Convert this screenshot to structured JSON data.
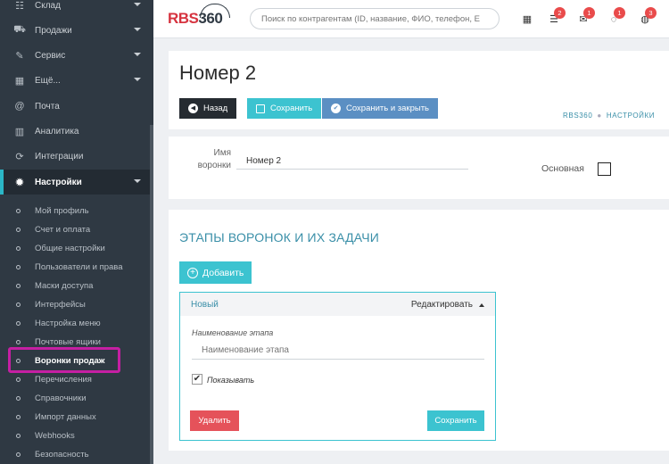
{
  "sidebar": {
    "items": [
      {
        "label": "Склад",
        "icon": "cubes-icon",
        "glyph": "☷",
        "caret": true
      },
      {
        "label": "Продажи",
        "icon": "cart-icon",
        "glyph": "⛟",
        "caret": true
      },
      {
        "label": "Сервис",
        "icon": "wrench-icon",
        "glyph": "✎",
        "caret": true
      },
      {
        "label": "Ещё...",
        "icon": "grid-icon",
        "glyph": "▦",
        "caret": true
      },
      {
        "label": "Почта",
        "icon": "at-icon",
        "glyph": "@",
        "caret": false
      },
      {
        "label": "Аналитика",
        "icon": "chart-icon",
        "glyph": "▥",
        "caret": false
      },
      {
        "label": "Интеграции",
        "icon": "refresh-icon",
        "glyph": "⟳",
        "caret": false
      },
      {
        "label": "Настройки",
        "icon": "gear-icon",
        "glyph": "✹",
        "caret": true
      }
    ],
    "subitems": [
      "Мой профиль",
      "Счет и оплата",
      "Общие настройки",
      "Пользователи и права",
      "Маски доступа",
      "Интерфейсы",
      "Настройка меню",
      "Почтовые ящики",
      "Воронки продаж",
      "Перечисления",
      "Справочники",
      "Импорт данных",
      "Webhooks",
      "Безопасность"
    ]
  },
  "topbar": {
    "logo_rbs": "RBS",
    "logo_num": "360",
    "search_placeholder": "Поиск по контрагентам (ID, название, ФИО, телефон, E",
    "icons": [
      {
        "name": "calendar-icon",
        "glyph": "▦",
        "badge": ""
      },
      {
        "name": "tasks-icon",
        "glyph": "☰",
        "badge": "2"
      },
      {
        "name": "mail-icon",
        "glyph": "✉",
        "badge": "1"
      },
      {
        "name": "comment-icon",
        "glyph": "◌",
        "badge": "1"
      },
      {
        "name": "comments-icon",
        "glyph": "◍",
        "badge": "3"
      }
    ]
  },
  "header": {
    "title": "Номер 2",
    "back": "Назад",
    "save": "Сохранить",
    "save_close": "Сохранить и закрыть",
    "breadcrumb": [
      "RBS360",
      "НАСТРОЙКИ"
    ]
  },
  "form": {
    "name_label": "Имя воронки",
    "name_value": "Номер 2",
    "main_label": "Основная"
  },
  "stages": {
    "title": "ЭТАПЫ ВОРОНОК И ИХ ЗАДАЧИ",
    "add": "Добавить",
    "card": {
      "name": "Новый",
      "edit": "Редактировать",
      "field_label": "Наименование этапа",
      "field_placeholder": "Наименование этапа",
      "show_label": "Показывать",
      "delete": "Удалить",
      "save": "Сохранить"
    }
  }
}
